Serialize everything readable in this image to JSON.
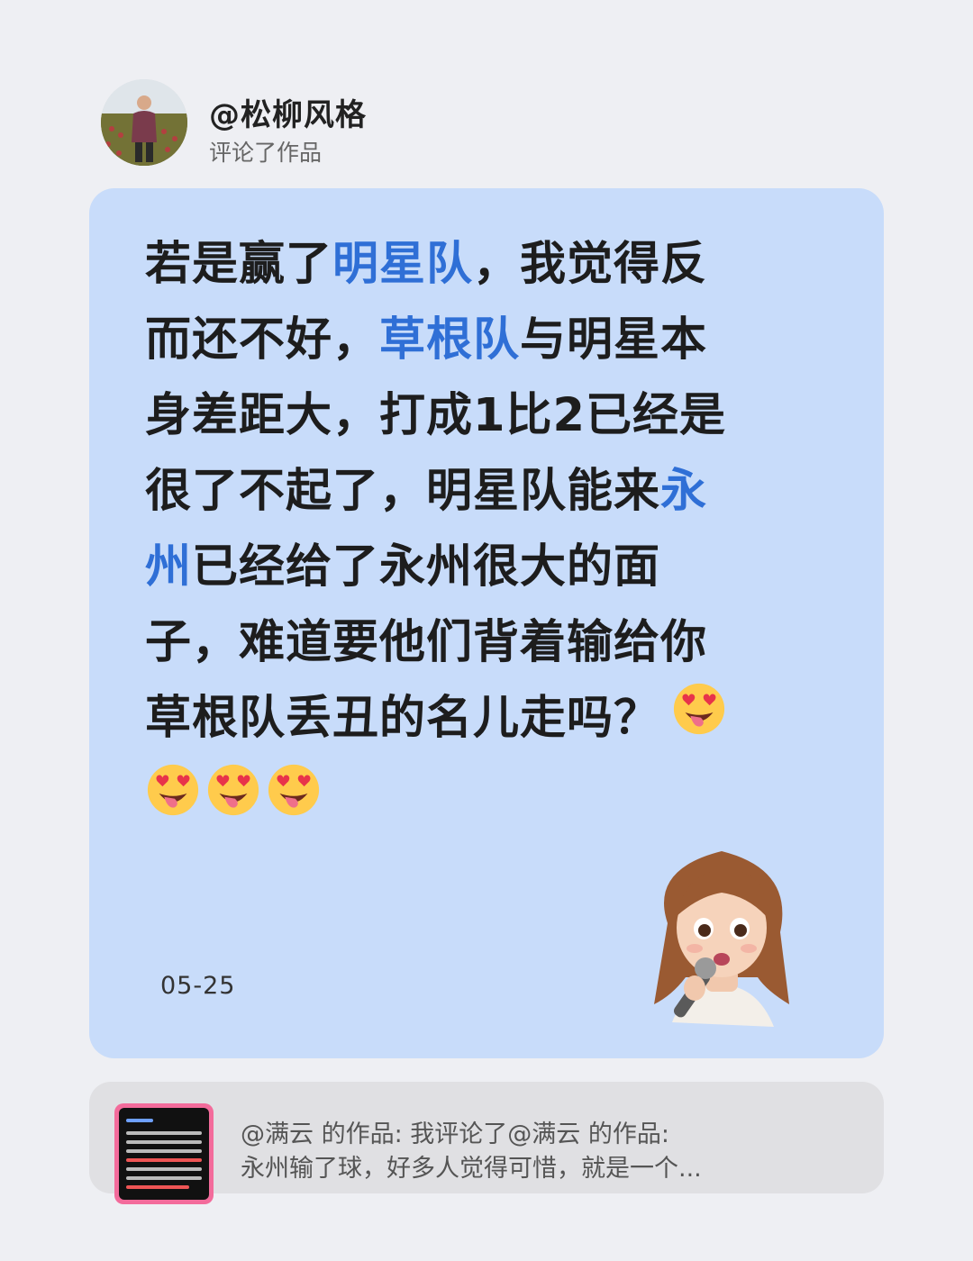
{
  "post": {
    "author": "@松柳风格",
    "action": "评论了作品"
  },
  "comment": {
    "lines": [
      [
        {
          "t": "若是赢了",
          "hl": false
        },
        {
          "t": "明星队",
          "hl": true
        },
        {
          "t": "，我觉得反",
          "hl": false
        }
      ],
      [
        {
          "t": "而还不好，",
          "hl": false
        },
        {
          "t": "草根队",
          "hl": true
        },
        {
          "t": "与明星本",
          "hl": false
        }
      ],
      [
        {
          "t": "身差距大，打成1比2已经是",
          "hl": false
        }
      ],
      [
        {
          "t": "很了不起了，明星队能来",
          "hl": false
        },
        {
          "t": "永",
          "hl": true
        }
      ],
      [
        {
          "t": "州",
          "hl": true
        },
        {
          "t": "已经给了永州很大的面",
          "hl": false
        }
      ],
      [
        {
          "t": "子，难道要他们背着输给你",
          "hl": false
        }
      ],
      [
        {
          "t": "草根队丢丑的名儿走吗？",
          "hl": false
        }
      ]
    ],
    "emoji_icon": "heart-eyes-tongue-emoji-icon",
    "emoji_count": 4,
    "date": "05-25",
    "sticker_icon": "memoji-girl-singing-icon",
    "highlight_color": "#2f6fd6",
    "card_color": "#c8dcfa"
  },
  "reference": {
    "line1": "@满云 的作品: 我评论了@满云 的作品:",
    "line2": "永州输了球，好多人觉得可惜，就是一个...",
    "thumbnail_icon": "video-thumbnail-icon"
  }
}
